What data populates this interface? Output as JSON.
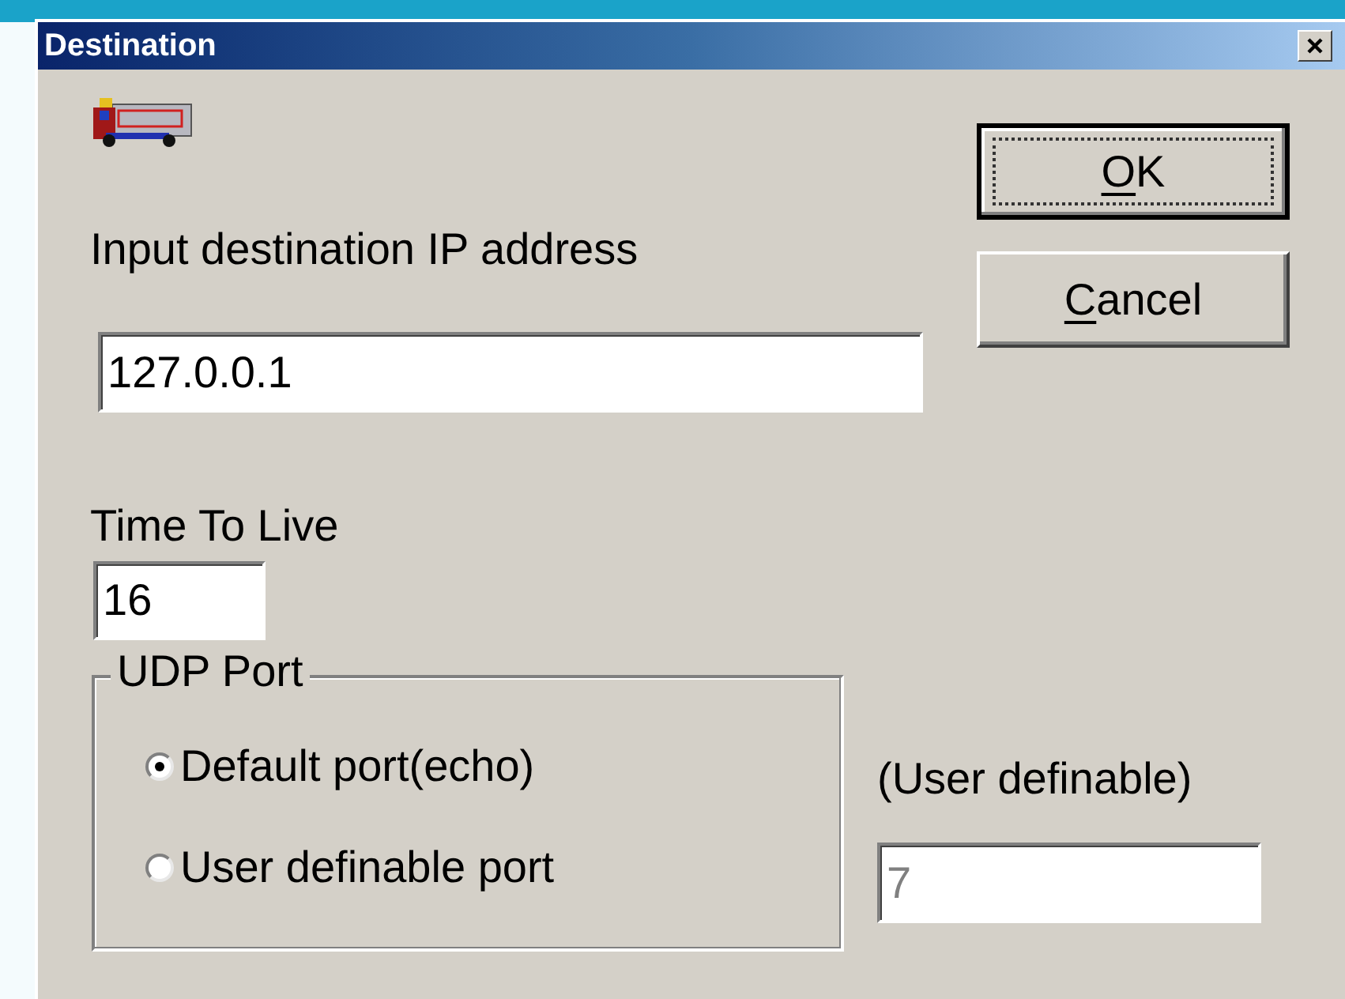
{
  "window": {
    "title": "Destination"
  },
  "ip": {
    "label": "Input destination IP address",
    "value": "127.0.0.1"
  },
  "ttl": {
    "label": "Time To Live",
    "value": "16"
  },
  "udp_port": {
    "title": "UDP Port",
    "options": [
      {
        "label": "Default port(echo)",
        "selected": true
      },
      {
        "label": "User definable port",
        "selected": false
      }
    ]
  },
  "user_port": {
    "label": "(User definable)",
    "value": "7",
    "disabled": true
  },
  "buttons": [
    {
      "label": "OK",
      "default": true
    },
    {
      "label": "Cancel",
      "default": false
    }
  ]
}
